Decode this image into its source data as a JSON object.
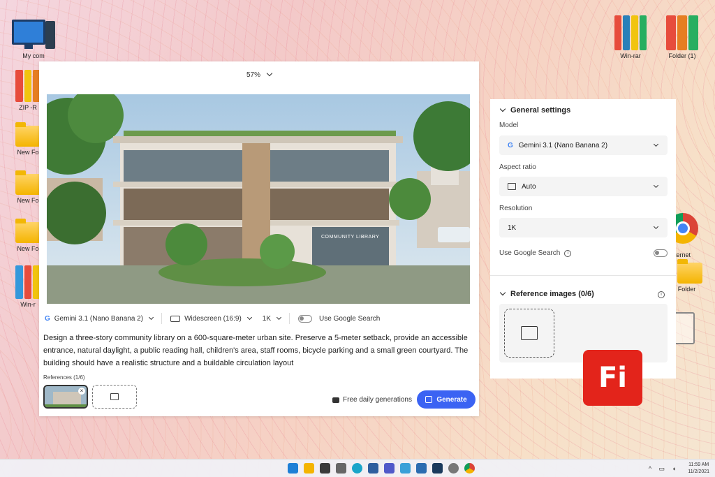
{
  "desktop": {
    "icons_left": [
      {
        "label": "My com",
        "kind": "computer"
      },
      {
        "label": "ZIP -R",
        "kind": "winrar"
      },
      {
        "label": "New Fo",
        "kind": "folder"
      },
      {
        "label": "New Fo",
        "kind": "folder"
      },
      {
        "label": "New Fo",
        "kind": "folder"
      },
      {
        "label": "Win-r",
        "kind": "winrar"
      }
    ],
    "icons_right": [
      {
        "label": "Win-rar",
        "kind": "winrar"
      },
      {
        "label": "Folder (1)",
        "kind": "winrar"
      }
    ],
    "partial_labels": {
      "internet": "nternet",
      "new_folder": "v Folder"
    }
  },
  "editor": {
    "zoom": "57%",
    "image_caption": "COMMUNITY LIBRARY",
    "toolbar": {
      "model": "Gemini 3.1 (Nano Banana 2)",
      "aspect": "Widescreen (16:9)",
      "resolution": "1K",
      "google_search": "Use Google Search"
    },
    "prompt": "Design a three-story community library on a 600-square-meter urban site. Preserve a 5-meter setback, provide an accessible entrance, natural daylight, a public reading hall, children's area, staff rooms, bicycle parking and a small green courtyard. The building should have a realistic structure and a buildable circulation layout",
    "references_label": "References (1/6)",
    "free_label": "Free daily generations",
    "generate_label": "Generate"
  },
  "panel": {
    "general_title": "General settings",
    "model_label": "Model",
    "model_value": "Gemini 3.1 (Nano Banana 2)",
    "aspect_label": "Aspect ratio",
    "aspect_value": "Auto",
    "resolution_label": "Resolution",
    "resolution_value": "1K",
    "search_label": "Use Google Search",
    "reference_title": "Reference images (0/6)"
  },
  "logo": {
    "text": "Fi",
    "color": "#e3241b"
  },
  "taskbar": {
    "time": "11:59 AM",
    "date": "11/2/2021"
  },
  "colors": {
    "accent": "#3b63f3"
  }
}
